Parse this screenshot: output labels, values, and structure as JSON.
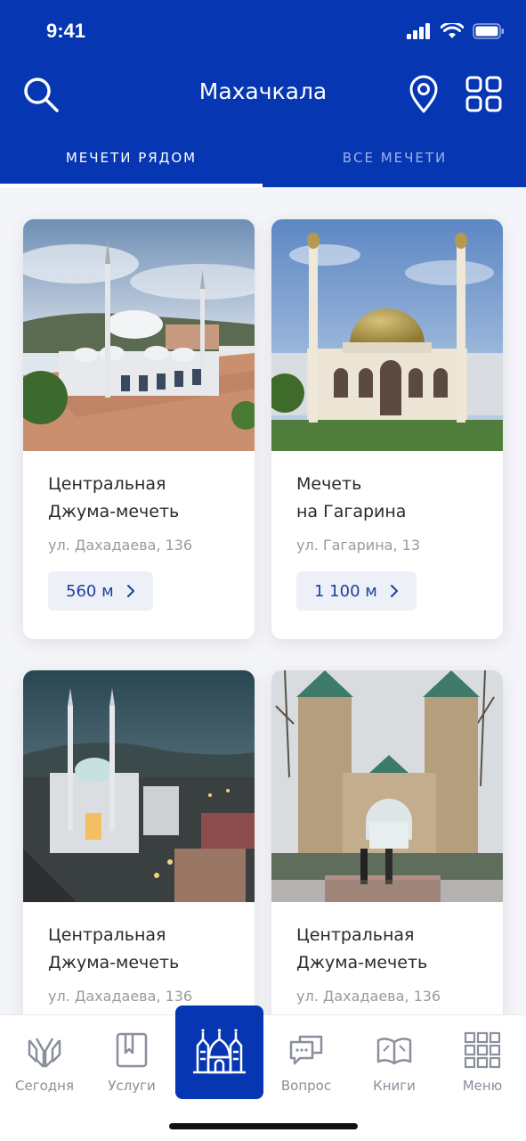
{
  "status_bar": {
    "time": "9:41"
  },
  "header": {
    "city": "Махачкала"
  },
  "tabs": [
    {
      "label": "МЕЧЕТИ РЯДОМ",
      "active": true
    },
    {
      "label": "ВСЕ МЕЧЕТИ",
      "active": false
    }
  ],
  "mosques": [
    {
      "title_line1": "Центральная",
      "title_line2": "Джума-мечеть",
      "address": "ул. Дахадаева, 136",
      "distance": "560 м"
    },
    {
      "title_line1": "Мечеть",
      "title_line2": "на Гагарина",
      "address": "ул. Гагарина, 13",
      "distance": "1 100 м"
    },
    {
      "title_line1": "Центральная",
      "title_line2": "Джума-мечеть",
      "address": "ул. Дахадаева, 136"
    },
    {
      "title_line1": "Центральная",
      "title_line2": "Джума-мечеть",
      "address": "ул. Дахадаева, 136"
    }
  ],
  "tab_bar": {
    "items": [
      {
        "label": "Сегодня",
        "icon": "praying-hands-icon"
      },
      {
        "label": "Услуги",
        "icon": "book-tag-icon"
      },
      {
        "label": "",
        "icon": "mosque-icon",
        "active": true
      },
      {
        "label": "Вопрос",
        "icon": "chat-bubble-icon"
      },
      {
        "label": "Книги",
        "icon": "open-book-icon"
      },
      {
        "label": "Меню",
        "icon": "grid-menu-icon"
      }
    ]
  },
  "colors": {
    "brand": "#0636b1",
    "inactive_tab": "#9fb2e6",
    "distance_text": "#1f3f9f",
    "tab_icon": "#8b8f9c"
  }
}
